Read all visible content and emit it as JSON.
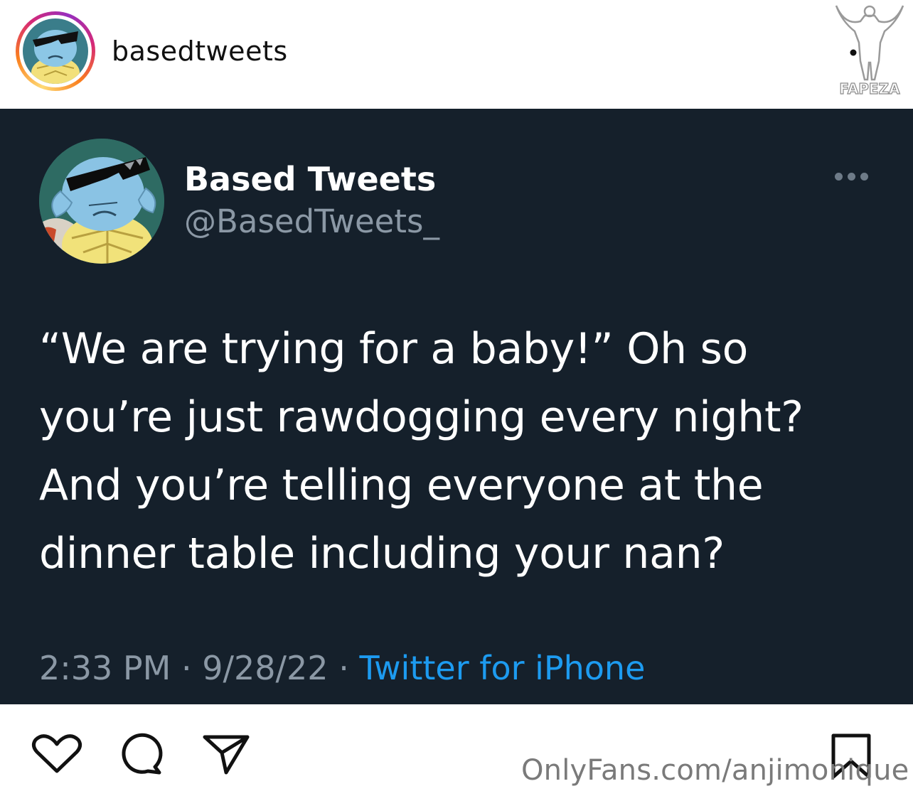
{
  "post": {
    "username": "basedtweets",
    "more_label": "•"
  },
  "watermark": {
    "brand": "FAPEZA",
    "onlyfans_url": "OnlyFans.com/anjimonique"
  },
  "tweet": {
    "display_name": "Based Tweets",
    "handle": "@BasedTweets_",
    "text": "“We are trying for a baby!” Oh so you’re just rawdogging every night? And you’re telling everyone at the dinner table including your nan?",
    "time": "2:33 PM",
    "separator": " · ",
    "date": "9/28/22",
    "source": "Twitter for iPhone"
  },
  "colors": {
    "tweet_bg": "#15202b",
    "secondary_text": "#8b98a5",
    "link_blue": "#1d9bf0",
    "story_ring": [
      "#feda75",
      "#fa7e1e",
      "#d62976",
      "#962fbf"
    ]
  },
  "icons": {
    "like": "heart-icon",
    "comment": "comment-icon",
    "share": "paper-plane-icon",
    "save": "bookmark-icon",
    "tweet_menu": "more-horizontal-icon"
  }
}
